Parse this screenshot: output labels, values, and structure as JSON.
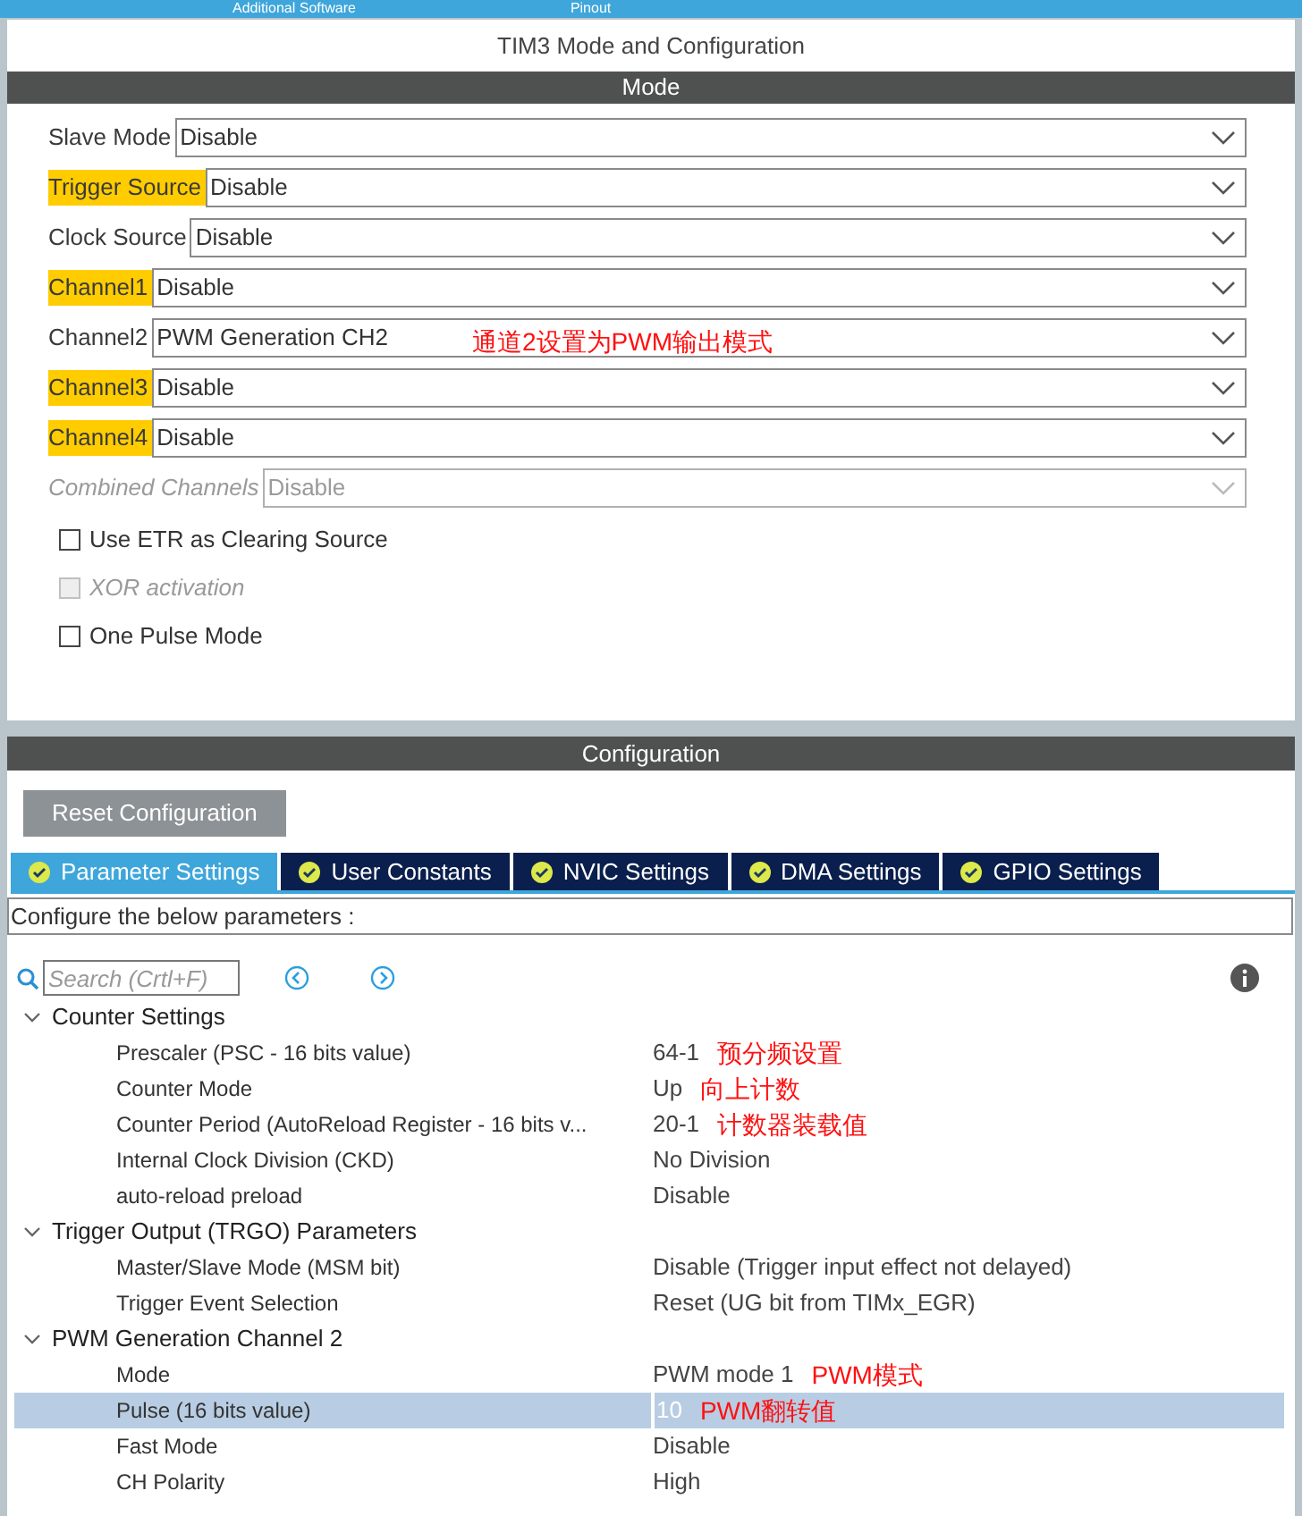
{
  "top_bar": {
    "tabs": [
      "Additional Software",
      "Pinout"
    ]
  },
  "panel_title": "TIM3 Mode and Configuration",
  "mode": {
    "title": "Mode",
    "fields": [
      {
        "label": "Slave Mode",
        "value": "Disable",
        "highlighted": false,
        "disabled": false
      },
      {
        "label": "Trigger Source",
        "value": "Disable",
        "highlighted": true,
        "disabled": false
      },
      {
        "label": "Clock Source",
        "value": "Disable",
        "highlighted": false,
        "disabled": false
      },
      {
        "label": "Channel1",
        "value": "Disable",
        "highlighted": true,
        "disabled": false
      },
      {
        "label": "Channel2",
        "value": "PWM Generation CH2",
        "highlighted": false,
        "disabled": false,
        "note": "通道2设置为PWM输出模式"
      },
      {
        "label": "Channel3",
        "value": "Disable",
        "highlighted": true,
        "disabled": false
      },
      {
        "label": "Channel4",
        "value": "Disable",
        "highlighted": true,
        "disabled": false
      },
      {
        "label": "Combined Channels",
        "value": "Disable",
        "highlighted": false,
        "disabled": true
      }
    ],
    "checkboxes": [
      {
        "label": "Use ETR as Clearing Source",
        "checked": false,
        "disabled": false
      },
      {
        "label": "XOR activation",
        "checked": false,
        "disabled": true
      },
      {
        "label": "One Pulse Mode",
        "checked": false,
        "disabled": false
      }
    ]
  },
  "configuration": {
    "title": "Configuration",
    "reset_button": "Reset Configuration",
    "tabs": [
      {
        "label": "Parameter Settings",
        "selected": true
      },
      {
        "label": "User Constants",
        "selected": false
      },
      {
        "label": "NVIC Settings",
        "selected": false
      },
      {
        "label": "DMA Settings",
        "selected": false
      },
      {
        "label": "GPIO Settings",
        "selected": false
      }
    ],
    "description": "Configure the below parameters :",
    "search": {
      "placeholder": "Search (Crtl+F)"
    },
    "groups": [
      {
        "title": "Counter Settings",
        "expanded": true,
        "children": [
          {
            "name": "Prescaler (PSC - 16 bits value)",
            "value": "64-1",
            "selected": false,
            "note": "预分频设置"
          },
          {
            "name": "Counter Mode",
            "value": "Up",
            "selected": false,
            "note": "向上计数"
          },
          {
            "name": "Counter Period (AutoReload Register - 16 bits v...",
            "value": "20-1",
            "selected": false,
            "note": "计数器装载值"
          },
          {
            "name": "Internal Clock Division (CKD)",
            "value": "No Division",
            "selected": false
          },
          {
            "name": "auto-reload preload",
            "value": "Disable",
            "selected": false
          }
        ]
      },
      {
        "title": "Trigger Output (TRGO) Parameters",
        "expanded": true,
        "children": [
          {
            "name": "Master/Slave Mode (MSM bit)",
            "value": "Disable (Trigger input effect not delayed)",
            "selected": false
          },
          {
            "name": "Trigger Event Selection",
            "value": "Reset (UG bit from TIMx_EGR)",
            "selected": false
          }
        ]
      },
      {
        "title": "PWM Generation Channel 2",
        "expanded": true,
        "children": [
          {
            "name": "Mode",
            "value": "PWM mode 1",
            "selected": false,
            "note": "PWM模式"
          },
          {
            "name": "Pulse (16 bits value)",
            "value": "10",
            "selected": true,
            "note": "PWM翻转值"
          },
          {
            "name": "Fast Mode",
            "value": "Disable",
            "selected": false
          },
          {
            "name": "CH Polarity",
            "value": "High",
            "selected": false
          }
        ]
      }
    ]
  }
}
